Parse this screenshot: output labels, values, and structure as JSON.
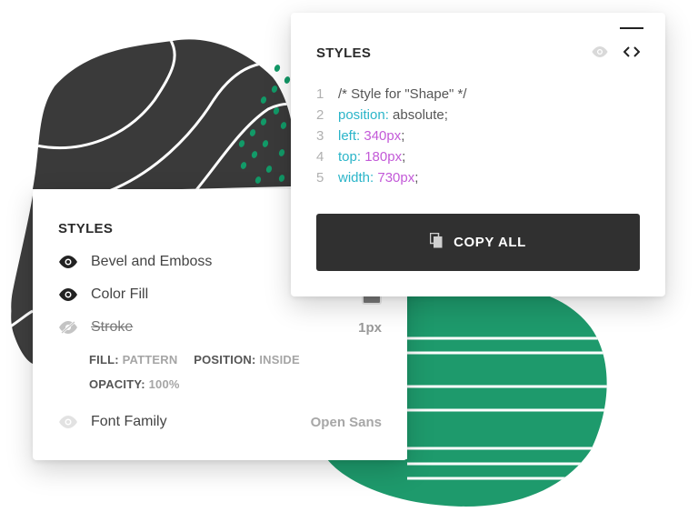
{
  "styles_panel": {
    "title": "STYLES",
    "items": [
      {
        "label": "Bevel and Emboss",
        "visible": true
      },
      {
        "label": "Color Fill",
        "visible": true,
        "swatch_color": "#777777"
      },
      {
        "label": "Stroke",
        "visible": false,
        "value": "1px"
      },
      {
        "label": "Font Family",
        "visible": "faded",
        "value": "Open Sans"
      }
    ],
    "stroke_details": {
      "fill_key": "FILL:",
      "fill_val": "PATTERN",
      "position_key": "POSITION:",
      "position_val": "INSIDE",
      "opacity_key": "OPACITY:",
      "opacity_val": "100%"
    }
  },
  "code_panel": {
    "title": "STYLES",
    "lines": [
      {
        "num": "1",
        "comment": "/* Style for \"Shape\" */"
      },
      {
        "num": "2",
        "prop": "position",
        "value": "absolute",
        "value_kind": "plain"
      },
      {
        "num": "3",
        "prop": "left",
        "value": "340px",
        "value_kind": "number"
      },
      {
        "num": "4",
        "prop": "top",
        "value": "180px",
        "value_kind": "number"
      },
      {
        "num": "5",
        "prop": "width",
        "value": "730px",
        "value_kind": "number"
      }
    ],
    "copy_label": "COPY ALL",
    "icons": [
      "eye-icon",
      "code-icon",
      "copy-icon"
    ]
  },
  "colors": {
    "dark_shape": "#3a3a3a",
    "green_shape": "#1e9a6c",
    "dots": "#129a68",
    "prop_color": "#2bb5c9",
    "number_color": "#c35ad8",
    "button_bg": "#303030"
  }
}
